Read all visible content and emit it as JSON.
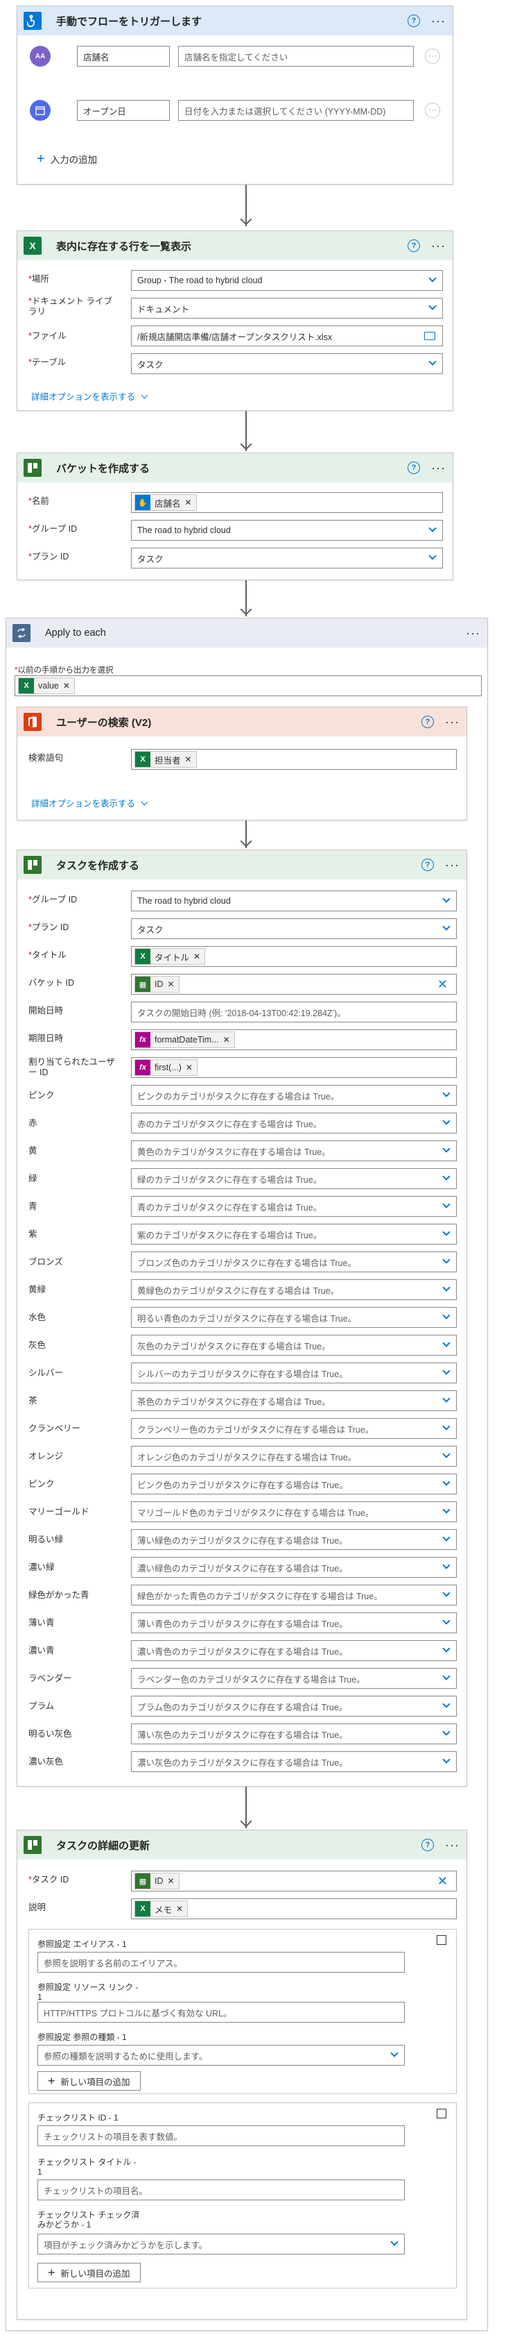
{
  "colors": {
    "trigger_head": "#dbe9f9",
    "excel_head": "#e5f1e8",
    "planner_head": "#e5f1e8",
    "apply_head": "#e9ecf2",
    "office_head": "#f9e1db",
    "accent": "#0078d4"
  },
  "trigger": {
    "title": "手動でフローをトリガーします",
    "icon": "hand-touch-icon",
    "inputs": [
      {
        "name": "店舗名",
        "placeholder": "店舗名を指定してください",
        "icon": "text-icon"
      },
      {
        "name": "オープン日",
        "placeholder": "日付を入力または選択してください (YYYY-MM-DD)",
        "icon": "calendar-icon"
      }
    ],
    "add_input": "入力の追加"
  },
  "list_rows": {
    "title": "表内に存在する行を一覧表示",
    "fields": [
      {
        "label": "場所",
        "value": "Group - The road to hybrid cloud"
      },
      {
        "label": "ドキュメント ライブラリ",
        "value": "ドキュメント"
      },
      {
        "label": "ファイル",
        "value": "/新規店舗開店準備/店舗オープンタスクリスト.xlsx"
      },
      {
        "label": "テーブル",
        "value": "タスク"
      }
    ],
    "advanced": "詳細オプションを表示する"
  },
  "create_bucket": {
    "title": "バケットを作成する",
    "name_label": "名前",
    "name_token": "店舗名",
    "group_label": "グループ ID",
    "group_value": "The road to hybrid cloud",
    "plan_label": "プラン ID",
    "plan_value": "タスク"
  },
  "apply_each": {
    "title": "Apply to each",
    "select_label": "以前の手順から出力を選択",
    "select_token": "value"
  },
  "search_user": {
    "title": "ユーザーの検索 (V2)",
    "term_label": "検索語句",
    "term_token": "担当者",
    "advanced": "詳細オプションを表示する"
  },
  "create_task": {
    "title": "タスクを作成する",
    "group_label": "グループ ID",
    "group_value": "The road to hybrid cloud",
    "plan_label": "プラン ID",
    "plan_value": "タスク",
    "title_label": "タイトル",
    "title_token": "タイトル",
    "bucket_label": "バケット ID",
    "bucket_token": "ID",
    "start_label": "開始日時",
    "start_placeholder": "タスクの開始日時 (例: '2018-04-13T00:42:19.284Z')。",
    "due_label": "期限日時",
    "due_token": "formatDateTim...",
    "assign_label": "割り当てられたユーザー ID",
    "assign_token": "first(...)",
    "categories": [
      {
        "label": "ピンク",
        "text": "ピンクのカテゴリがタスクに存在する場合は True。"
      },
      {
        "label": "赤",
        "text": "赤のカテゴリがタスクに存在する場合は True。"
      },
      {
        "label": "黄",
        "text": "黄色のカテゴリがタスクに存在する場合は True。"
      },
      {
        "label": "緑",
        "text": "緑のカテゴリがタスクに存在する場合は True。"
      },
      {
        "label": "青",
        "text": "青のカテゴリがタスクに存在する場合は True。"
      },
      {
        "label": "紫",
        "text": "紫のカテゴリがタスクに存在する場合は True。"
      },
      {
        "label": "ブロンズ",
        "text": "ブロンズ色のカテゴリがタスクに存在する場合は True。"
      },
      {
        "label": "黄緑",
        "text": "黄緑色のカテゴリがタスクに存在する場合は True。"
      },
      {
        "label": "水色",
        "text": "明るい青色のカテゴリがタスクに存在する場合は True。"
      },
      {
        "label": "灰色",
        "text": "灰色のカテゴリがタスクに存在する場合は True。"
      },
      {
        "label": "シルバー",
        "text": "シルバーのカテゴリがタスクに存在する場合は True。"
      },
      {
        "label": "茶",
        "text": "茶色のカテゴリがタスクに存在する場合は True。"
      },
      {
        "label": "クランベリー",
        "text": "クランベリー色のカテゴリがタスクに存在する場合は True。"
      },
      {
        "label": "オレンジ",
        "text": "オレンジ色のカテゴリがタスクに存在する場合は True。"
      },
      {
        "label": "ピンク",
        "text": "ピンク色のカテゴリがタスクに存在する場合は True。"
      },
      {
        "label": "マリーゴールド",
        "text": "マリゴールド色のカテゴリがタスクに存在する場合は True。"
      },
      {
        "label": "明るい緑",
        "text": "薄い緑色のカテゴリがタスクに存在する場合は True。"
      },
      {
        "label": "濃い緑",
        "text": "濃い緑色のカテゴリがタスクに存在する場合は True。"
      },
      {
        "label": "緑色がかった青",
        "text": "緑色がかった青色のカテゴリがタスクに存在する場合は True。"
      },
      {
        "label": "薄い青",
        "text": "薄い青色のカテゴリがタスクに存在する場合は True。"
      },
      {
        "label": "濃い青",
        "text": "濃い青色のカテゴリがタスクに存在する場合は True。"
      },
      {
        "label": "ラベンダー",
        "text": "ラベンダー色のカテゴリがタスクに存在する場合は True。"
      },
      {
        "label": "プラム",
        "text": "プラム色のカテゴリがタスクに存在する場合は True。"
      },
      {
        "label": "明るい灰色",
        "text": "薄い灰色のカテゴリがタスクに存在する場合は True。"
      },
      {
        "label": "濃い灰色",
        "text": "濃い灰色のカテゴリがタスクに存在する場合は True。"
      }
    ]
  },
  "update_details": {
    "title": "タスクの詳細の更新",
    "task_label": "タスク ID",
    "task_token": "ID",
    "desc_label": "説明",
    "desc_token": "メモ",
    "ref_alias_label": "参照設定 エイリアス - 1",
    "ref_alias_ph": "参照を説明する名前のエイリアス。",
    "ref_link_label": "参照設定 リソース リンク - 1",
    "ref_link_ph": "HTTP/HTTPS プロトコルに基づく有効な URL。",
    "ref_type_label": "参照設定 参照の種類 - 1",
    "ref_type_ph": "参照の種類を説明するために使用します。",
    "add_item": "新しい項目の追加",
    "check_id_label": "チェックリスト ID - 1",
    "check_id_ph": "チェックリストの項目を表す数値。",
    "check_title_label": "チェックリスト タイトル - 1",
    "check_title_ph": "チェックリストの項目名。",
    "check_done_label": "チェックリスト チェック済みかどうか - 1",
    "check_done_ph": "項目がチェック済みかどうかを示します。",
    "add_item2": "新しい項目の追加"
  }
}
